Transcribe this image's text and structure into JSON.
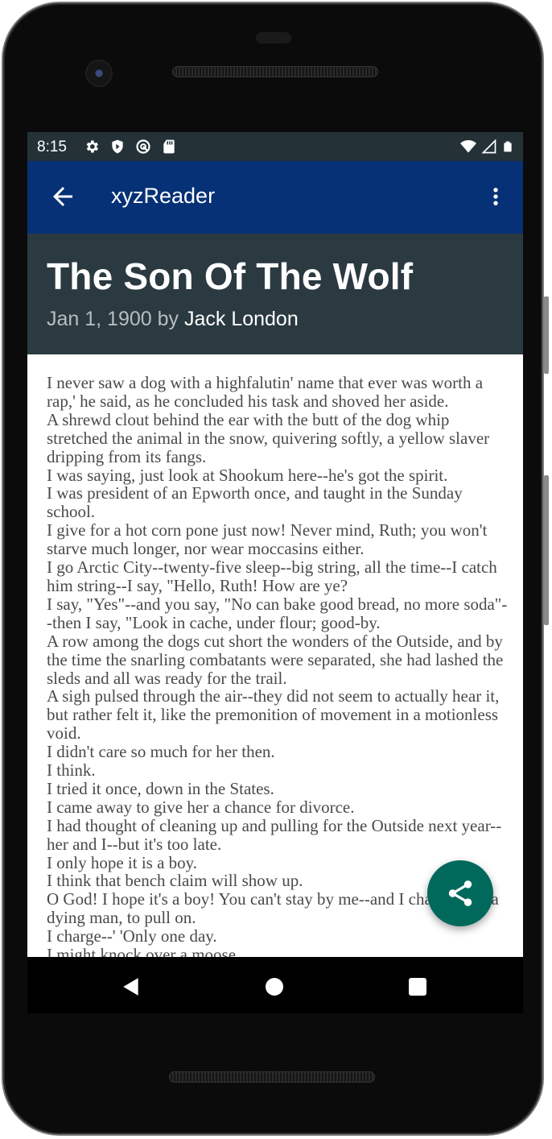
{
  "status_bar": {
    "time": "8:15",
    "left_icons": [
      "gear-icon",
      "shield-icon",
      "at-sign-icon",
      "sd-card-icon"
    ],
    "right_icons": [
      "wifi-icon",
      "signal-icon",
      "battery-icon"
    ]
  },
  "app_bar": {
    "title": "xyzReader",
    "back_icon": "arrow-left-icon",
    "more_icon": "more-vert-icon",
    "color": "#063176"
  },
  "article": {
    "title": "The Son Of The Wolf",
    "date": "Jan 1, 1900",
    "by_label": " by ",
    "author": "Jack London",
    "header_color": "#2b3940",
    "paragraphs": [
      "I never saw a dog with a highfalutin' name that ever was worth a rap,' he said, as he concluded his task and shoved her aside.",
      "A shrewd clout behind the ear with the butt of the dog whip stretched the animal in the snow, quivering softly, a yellow slaver dripping from its fangs.",
      "I was saying, just look at Shookum here--he's got the spirit.",
      "I was president of an Epworth once, and taught in the Sunday school.",
      "I give for a hot corn pone just now! Never mind, Ruth; you won't starve much longer, nor wear moccasins either.",
      "I go Arctic City--twenty-five sleep--big string, all the time--I catch him string--I say, \"Hello, Ruth! How are ye?",
      "I say, \"Yes\"--and you say, \"No can bake good bread, no more soda\"--then I say, \"Look in cache, under flour; good-by.",
      "A row among the dogs cut short the wonders of the Outside, and by the time the snarling combatants were separated, she had lashed the sleds and all was ready for the trail.",
      "A sigh pulsed through the air--they did not seem to actually hear it, but rather felt it, like the premonition of movement in a motionless void.",
      "I didn't care so much for her then.",
      "I think.",
      "I tried it once, down in the States.",
      "I came away to give her a chance for divorce.",
      "I had thought of cleaning up and pulling for the Outside next year--her and I--but it's too late.",
      "I only hope it is a boy.",
      "I think that bench claim will show up.",
      "O God! I hope it's a boy! You can't stay by me--and I charge you, a dying man, to pull on.",
      "I charge--' 'Only one day.",
      "I might knock over a moose."
    ]
  },
  "fab": {
    "icon": "share-icon",
    "color": "#00695c"
  },
  "nav_bar": {
    "icons": [
      "back-triangle-icon",
      "home-circle-icon",
      "recents-square-icon"
    ]
  }
}
